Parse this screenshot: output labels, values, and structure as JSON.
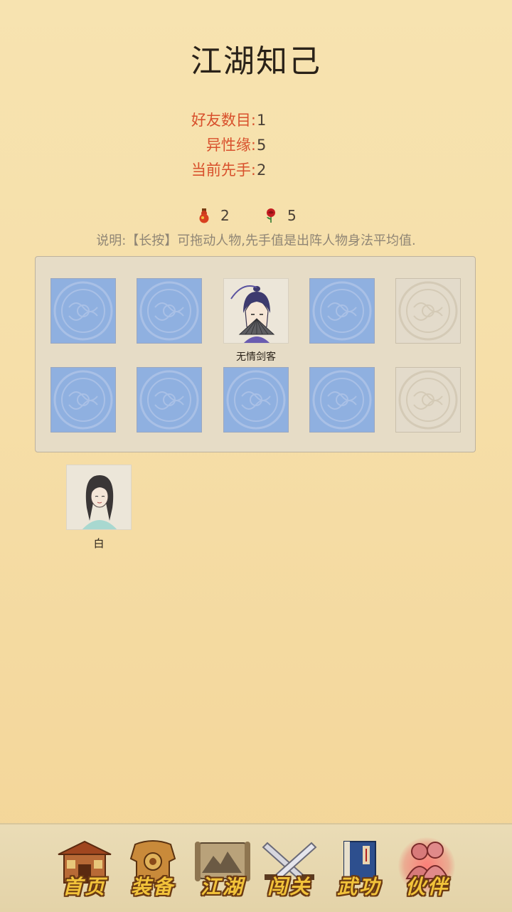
{
  "title": "江湖知己",
  "stats": [
    {
      "label": "好友数目:",
      "value": "1"
    },
    {
      "label": "异性缘:",
      "value": "5"
    },
    {
      "label": "当前先手:",
      "value": "2"
    }
  ],
  "counters": {
    "gourd": {
      "icon": "gourd-icon",
      "value": "2"
    },
    "rose": {
      "icon": "rose-icon",
      "value": "5"
    }
  },
  "hint": "说明:【长按】可拖动人物,先手值是出阵人物身法平均值.",
  "board": {
    "slots": [
      {
        "state": "empty",
        "name": ""
      },
      {
        "state": "empty",
        "name": ""
      },
      {
        "state": "character",
        "name": "无情剑客"
      },
      {
        "state": "empty",
        "name": ""
      },
      {
        "state": "locked",
        "name": ""
      },
      {
        "state": "empty",
        "name": ""
      },
      {
        "state": "empty",
        "name": ""
      },
      {
        "state": "empty",
        "name": ""
      },
      {
        "state": "empty",
        "name": ""
      },
      {
        "state": "locked",
        "name": ""
      }
    ]
  },
  "reserve": [
    {
      "name": "白"
    }
  ],
  "nav": [
    {
      "label": "首页",
      "icon": "house-icon"
    },
    {
      "label": "装备",
      "icon": "armor-icon"
    },
    {
      "label": "江湖",
      "icon": "scroll-map-icon"
    },
    {
      "label": "闯关",
      "icon": "crossed-swords-icon"
    },
    {
      "label": "武功",
      "icon": "book-icon"
    },
    {
      "label": "伙伴",
      "icon": "partners-icon",
      "active": true
    }
  ],
  "colors": {
    "stat_label": "#d8502c",
    "slot_blue": "#8fb0e0",
    "nav_text": "#f2c33a"
  }
}
